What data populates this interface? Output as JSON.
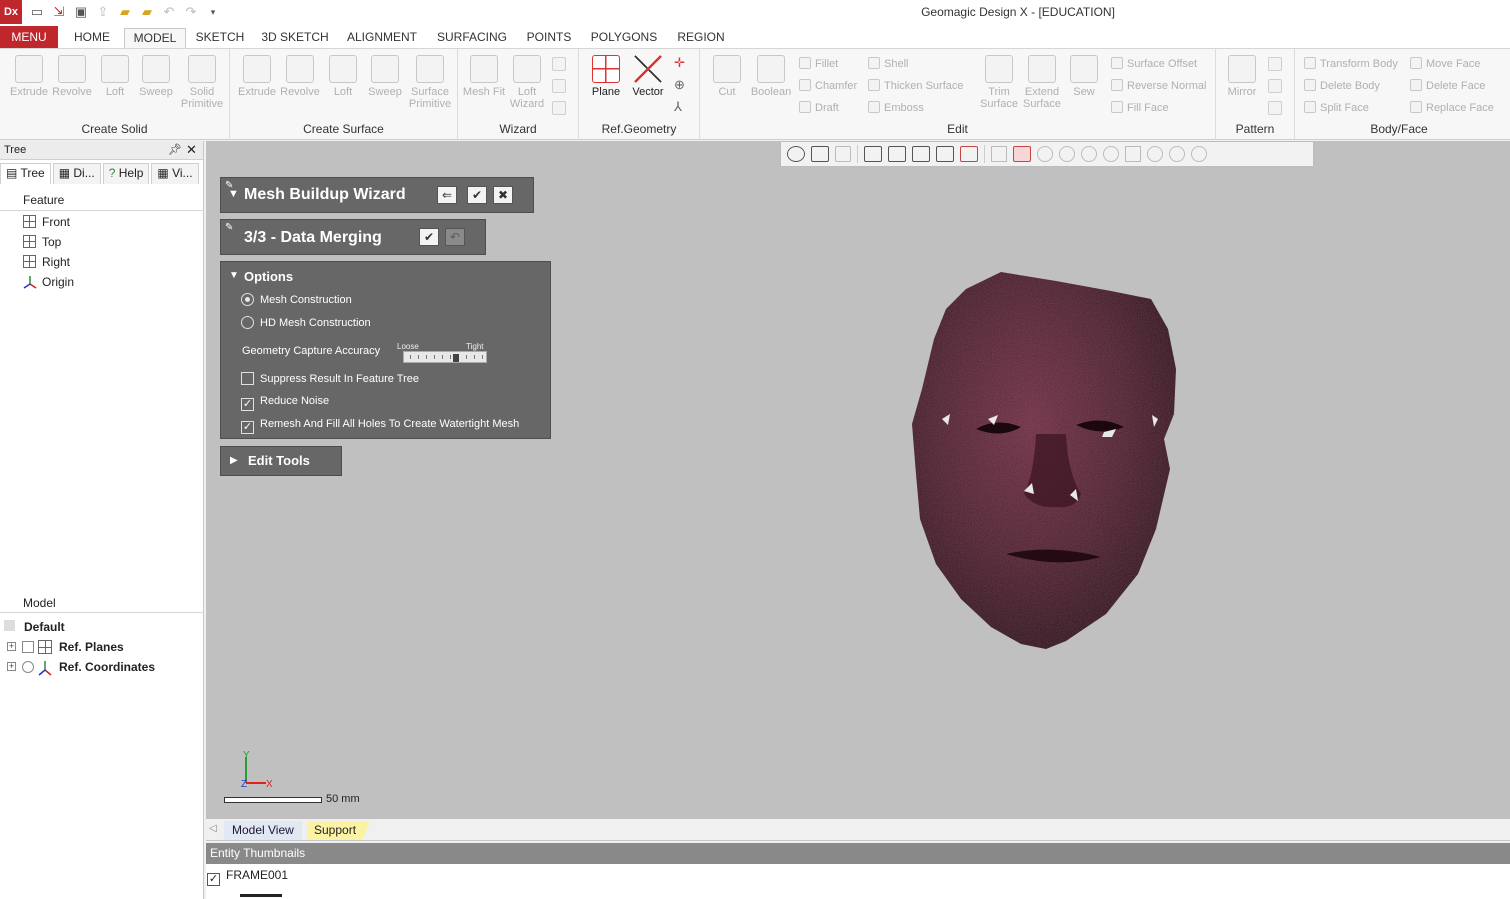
{
  "window": {
    "app_logo": "Dx",
    "title": "Geomagic Design X - [EDUCATION]"
  },
  "ribbon_tabs": [
    "MENU",
    "HOME",
    "MODEL",
    "SKETCH",
    "3D SKETCH",
    "ALIGNMENT",
    "SURFACING",
    "POINTS",
    "POLYGONS",
    "REGION"
  ],
  "ribbon_active_tab": "MODEL",
  "ribbon": {
    "create_solid": {
      "label": "Create Solid",
      "buttons": [
        "Extrude",
        "Revolve",
        "Loft",
        "Sweep",
        "Solid Primitive"
      ]
    },
    "create_surface": {
      "label": "Create Surface",
      "buttons": [
        "Extrude",
        "Revolve",
        "Loft",
        "Sweep",
        "Surface Primitive"
      ]
    },
    "wizard": {
      "label": "Wizard",
      "buttons": [
        "Mesh Fit",
        "Loft Wizard"
      ]
    },
    "ref_geometry": {
      "label": "Ref.Geometry",
      "buttons": [
        "Plane",
        "Vector"
      ]
    },
    "edit": {
      "label": "Edit",
      "big_buttons": [
        "Cut",
        "Boolean"
      ],
      "small_col1": [
        "Fillet",
        "Chamfer",
        "Draft"
      ],
      "small_col2": [
        "Shell",
        "Thicken Surface",
        "Emboss"
      ],
      "big_buttons2": [
        "Trim Surface",
        "Extend Surface",
        "Sew"
      ],
      "small_col3": [
        "Surface Offset",
        "Reverse Normal",
        "Fill Face"
      ]
    },
    "pattern": {
      "label": "Pattern",
      "buttons": [
        "Mirror"
      ]
    },
    "body_face": {
      "label": "Body/Face",
      "small_col1": [
        "Transform Body",
        "Delete Body",
        "Split Face"
      ],
      "small_col2": [
        "Move Face",
        "Delete Face",
        "Replace Face"
      ]
    }
  },
  "left_panel": {
    "title": "Tree",
    "tabs": [
      "Tree",
      "Di...",
      "Help",
      "Vi..."
    ],
    "feature_header": "Feature",
    "feature_items": [
      "Front",
      "Top",
      "Right",
      "Origin"
    ],
    "model_header": "Model",
    "model_default": "Default",
    "model_items": [
      "Ref. Planes",
      "Ref. Coordinates"
    ]
  },
  "wizard": {
    "title": "Mesh Buildup Wizard",
    "step_title": "3/3 - Data Merging",
    "options_title": "Options",
    "options": {
      "mesh_construction": "Mesh Construction",
      "hd_mesh_construction": "HD Mesh Construction",
      "accuracy_label": "Geometry Capture Accuracy",
      "slider_loose": "Loose",
      "slider_tight": "Tight",
      "slider_value": 0.65,
      "suppress_result": "Suppress Result In Feature Tree",
      "reduce_noise": "Reduce Noise",
      "remesh_fill": "Remesh And Fill All Holes To Create Watertight Mesh"
    },
    "edit_tools_title": "Edit Tools"
  },
  "viewport": {
    "scale_label": "50 mm",
    "axis_y": "Y",
    "axis_z": "Z",
    "axis_x": "X"
  },
  "bottom_tabs": {
    "model_view": "Model View",
    "support": "Support"
  },
  "entity_thumbnails": {
    "header": "Entity Thumbnails",
    "item": "FRAME001"
  },
  "colors": {
    "accent_red": "#c0272d",
    "wizard_panel": "#676767",
    "viewport_bg": "#c0c0c0",
    "mesh_color": "#5a2035"
  }
}
